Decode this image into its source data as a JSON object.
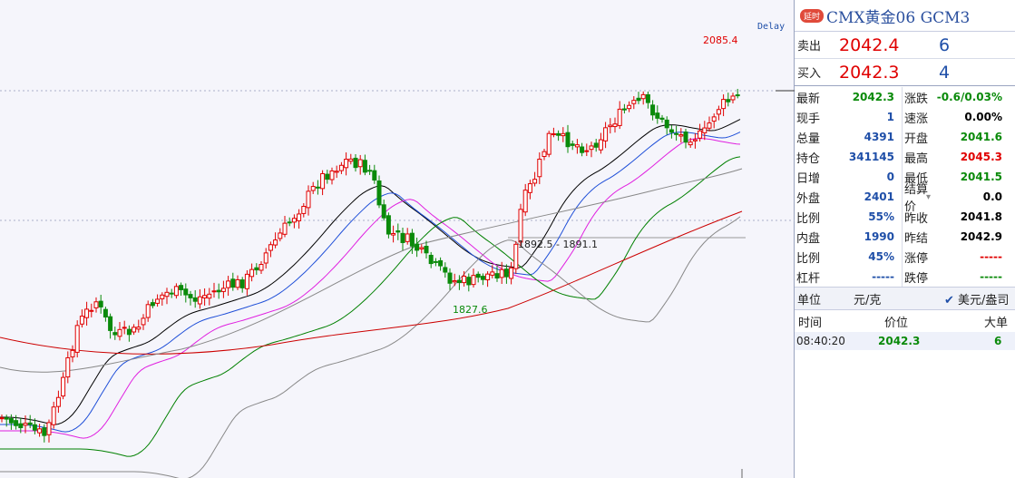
{
  "chart": {
    "delay_label": "Delay",
    "high_label": "2085.4",
    "low_label": "1827.6",
    "gap_label": "1892.5 - 1891.1"
  },
  "panel": {
    "badge": "延时",
    "title": "CMX黄金06  GCM3",
    "ask": {
      "label": "卖出",
      "price": "2042.4",
      "vol": "6"
    },
    "bid": {
      "label": "买入",
      "price": "2042.3",
      "vol": "4"
    },
    "quotes": [
      [
        {
          "label": "最新",
          "value": "2042.3",
          "color": "green"
        },
        {
          "label": "涨跌",
          "value": "-0.6/0.03%",
          "color": "green"
        }
      ],
      [
        {
          "label": "现手",
          "value": "1",
          "color": "blue"
        },
        {
          "label": "速涨",
          "value": "0.00%",
          "color": "black"
        }
      ],
      [
        {
          "label": "总量",
          "value": "4391",
          "color": "blue"
        },
        {
          "label": "开盘",
          "value": "2041.6",
          "color": "green"
        }
      ],
      [
        {
          "label": "持仓",
          "value": "341145",
          "color": "blue"
        },
        {
          "label": "最高",
          "value": "2045.3",
          "color": "red"
        }
      ],
      [
        {
          "label": "日增",
          "value": "0",
          "color": "blue"
        },
        {
          "label": "最低",
          "value": "2041.5",
          "color": "green"
        }
      ],
      [
        {
          "label": "外盘",
          "value": "2401",
          "color": "blue"
        },
        {
          "label": "结算价",
          "value": "0.0",
          "color": "black"
        }
      ],
      [
        {
          "label": "比例",
          "value": "55%",
          "color": "blue"
        },
        {
          "label": "昨收",
          "value": "2041.8",
          "color": "black"
        }
      ],
      [
        {
          "label": "内盘",
          "value": "1990",
          "color": "blue"
        },
        {
          "label": "昨结",
          "value": "2042.9",
          "color": "black"
        }
      ],
      [
        {
          "label": "比例",
          "value": "45%",
          "color": "blue"
        },
        {
          "label": "涨停",
          "value": "-----",
          "color": "red"
        }
      ],
      [
        {
          "label": "杠杆",
          "value": "-----",
          "color": "blue"
        },
        {
          "label": "跌停",
          "value": "-----",
          "color": "green"
        }
      ]
    ],
    "unit": {
      "label": "单位",
      "value": "元/克",
      "option": "美元/盎司"
    },
    "trades_header": {
      "time": "时间",
      "price": "价位",
      "size": "大单"
    },
    "trades": [
      {
        "time": "08:40:20",
        "price": "2042.3",
        "size": "6"
      }
    ]
  },
  "colors": {
    "up": "#e00000",
    "down": "#0a8a0a",
    "ma5": "#000000",
    "ma10": "#1f4fd8",
    "ma20": "#e020e0",
    "ma40": "#008000",
    "ma60": "#888888",
    "ma120": "#cc0000"
  }
}
